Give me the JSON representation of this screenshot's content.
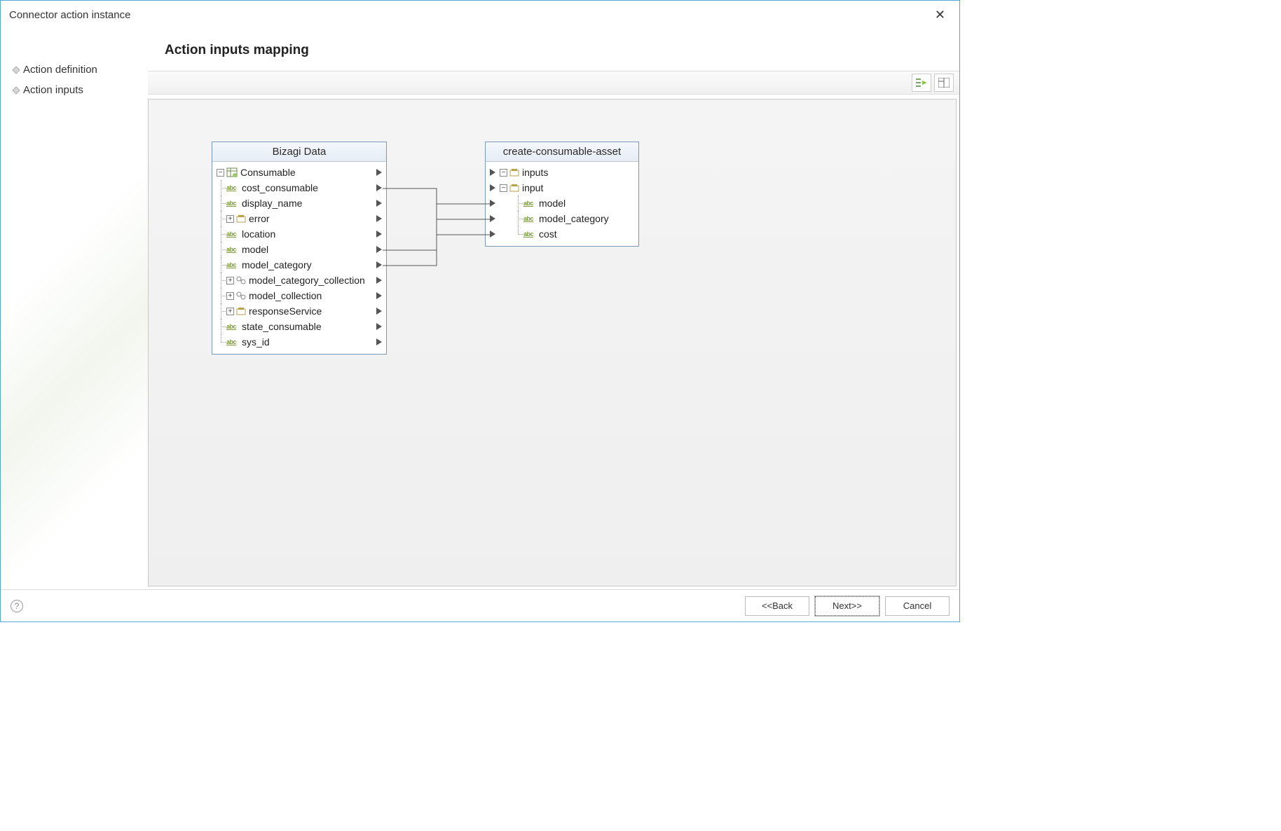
{
  "window": {
    "title": "Connector action instance"
  },
  "sidebar": {
    "items": [
      {
        "label": "Action definition"
      },
      {
        "label": "Action inputs"
      }
    ]
  },
  "heading": "Action inputs mapping",
  "source_panel": {
    "title": "Bizagi Data",
    "root": {
      "label": "Consumable",
      "icon": "entity",
      "expand": "minus"
    },
    "fields": [
      {
        "label": "cost_consumable",
        "icon": "abc"
      },
      {
        "label": "display_name",
        "icon": "abc"
      },
      {
        "label": "error",
        "icon": "box",
        "expand": "plus"
      },
      {
        "label": "location",
        "icon": "abc"
      },
      {
        "label": "model",
        "icon": "abc"
      },
      {
        "label": "model_category",
        "icon": "abc"
      },
      {
        "label": "model_category_collection",
        "icon": "coll",
        "expand": "plus"
      },
      {
        "label": "model_collection",
        "icon": "coll",
        "expand": "plus"
      },
      {
        "label": "responseService",
        "icon": "box",
        "expand": "plus"
      },
      {
        "label": "state_consumable",
        "icon": "abc"
      },
      {
        "label": "sys_id",
        "icon": "abc"
      }
    ]
  },
  "target_panel": {
    "title": "create-consumable-asset",
    "root": {
      "label": "inputs",
      "icon": "box",
      "expand": "minus"
    },
    "child": {
      "label": "input",
      "icon": "box",
      "expand": "minus"
    },
    "fields": [
      {
        "label": "model",
        "icon": "abc"
      },
      {
        "label": "model_category",
        "icon": "abc"
      },
      {
        "label": "cost",
        "icon": "abc"
      }
    ]
  },
  "connections": [
    {
      "from": "cost_consumable",
      "to": "cost"
    },
    {
      "from": "model",
      "to": "model"
    },
    {
      "from": "model_category",
      "to": "model_category"
    }
  ],
  "footer": {
    "back": "<<Back",
    "next": "Next>>",
    "cancel": "Cancel"
  }
}
